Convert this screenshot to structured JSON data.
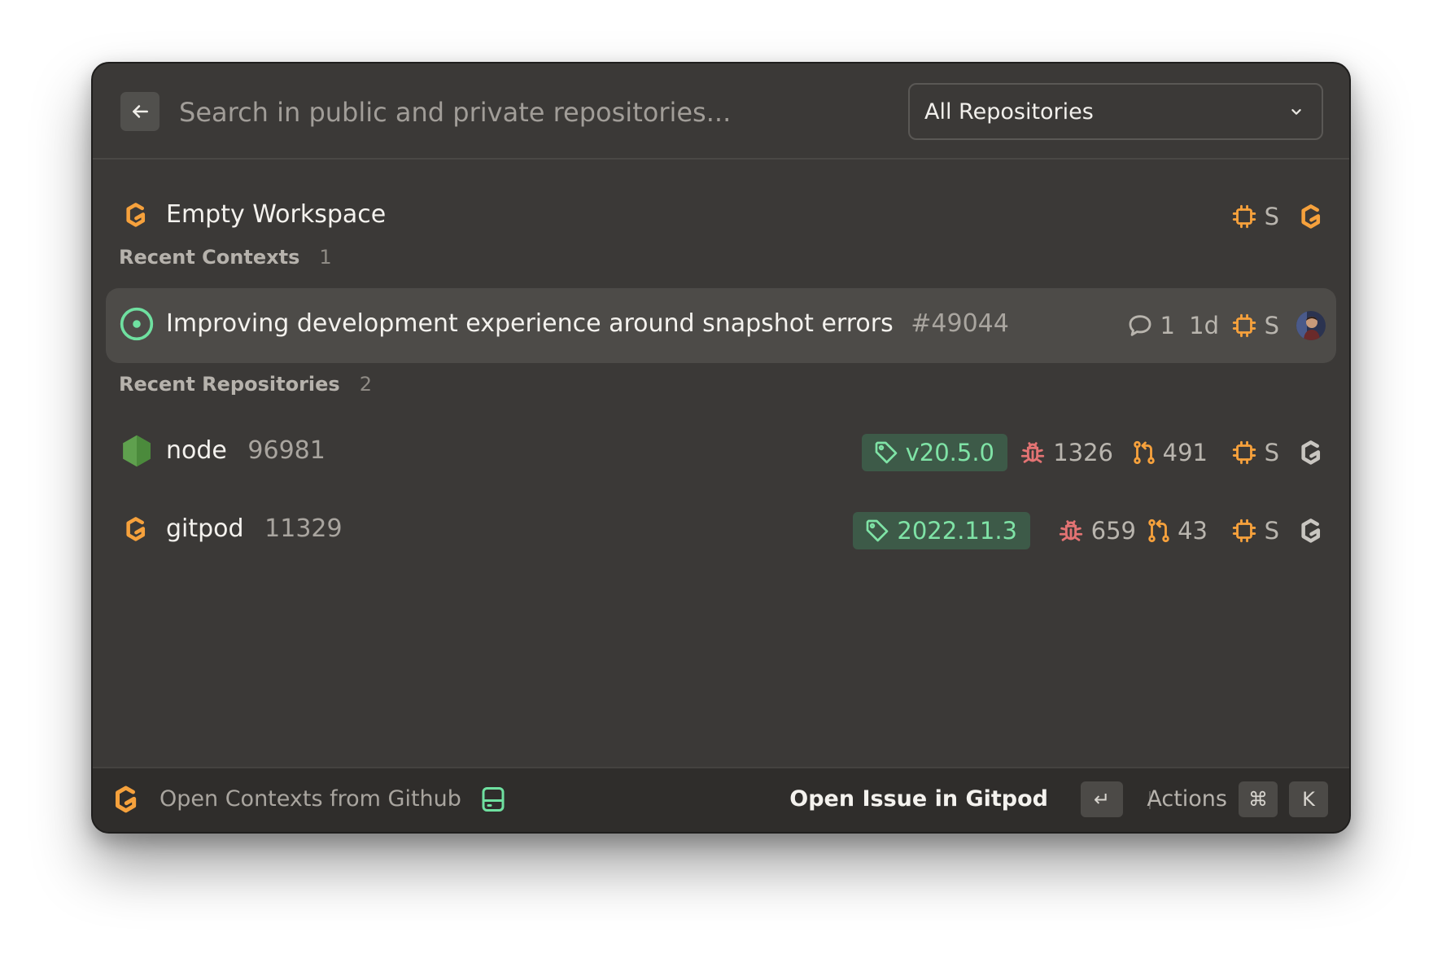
{
  "colors": {
    "accent": "#f6a13c",
    "tag_bg": "#3d5a48",
    "tag_text": "#7fe3a6",
    "bug": "#e37373",
    "open_issue": "#6fe0a0"
  },
  "search": {
    "placeholder": "Search in public and private repositories..."
  },
  "scope_select": {
    "value": "All Repositories"
  },
  "empty_workspace": {
    "label": "Empty Workspace",
    "size": "S"
  },
  "recent_contexts": {
    "heading": "Recent Contexts",
    "count": "1",
    "items": [
      {
        "title": "Improving development experience around snapshot errors",
        "number": "#49044",
        "comments": "1",
        "age": "1d",
        "size": "S"
      }
    ]
  },
  "recent_repositories": {
    "heading": "Recent Repositories",
    "count": "2",
    "items": [
      {
        "name": "node",
        "id": "96981",
        "tag": "v20.5.0",
        "issues": "1326",
        "prs": "491",
        "size": "S"
      },
      {
        "name": "gitpod",
        "id": "11329",
        "tag": "2022.11.3",
        "issues": "659",
        "prs": "43",
        "size": "S"
      }
    ]
  },
  "footer": {
    "source_label": "Open Contexts from Github",
    "primary_action": "Open Issue in Gitpod",
    "enter_key": "↵",
    "actions_label": "Actions",
    "cmd_key": "⌘",
    "k_key": "K"
  }
}
